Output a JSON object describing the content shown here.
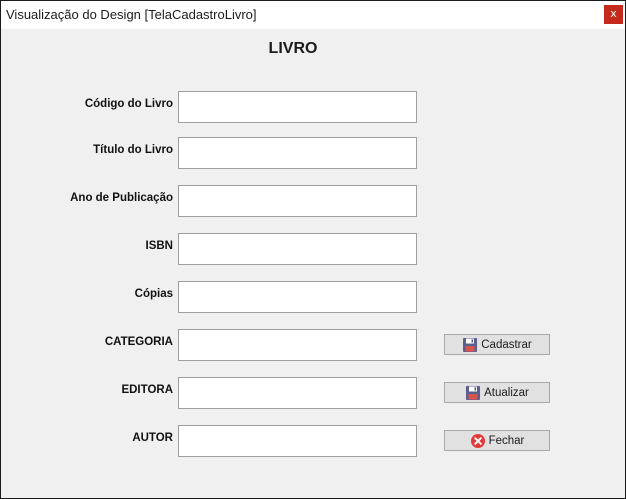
{
  "window": {
    "title": "Visualização do Design [TelaCadastroLivro]",
    "close_glyph": "x"
  },
  "form": {
    "heading": "LIVRO",
    "fields": [
      {
        "label": "Código do Livro",
        "value": ""
      },
      {
        "label": "Título do Livro",
        "value": ""
      },
      {
        "label": "Ano de Publicação",
        "value": ""
      },
      {
        "label": "ISBN",
        "value": ""
      },
      {
        "label": "Cópias",
        "value": ""
      },
      {
        "label": "CATEGORIA",
        "value": ""
      },
      {
        "label": "EDITORA",
        "value": ""
      },
      {
        "label": "AUTOR",
        "value": ""
      }
    ]
  },
  "buttons": {
    "cadastrar": {
      "label": "Cadastrar",
      "icon": "floppy-disk-icon"
    },
    "atualizar": {
      "label": "Atualizar",
      "icon": "floppy-disk-icon"
    },
    "fechar": {
      "label": "Fechar",
      "icon": "close-circle-icon"
    }
  },
  "colors": {
    "close_button": "#c42b1c",
    "fechar_icon": "#e23a3a",
    "floppy_icon": "#5a5f8c"
  }
}
